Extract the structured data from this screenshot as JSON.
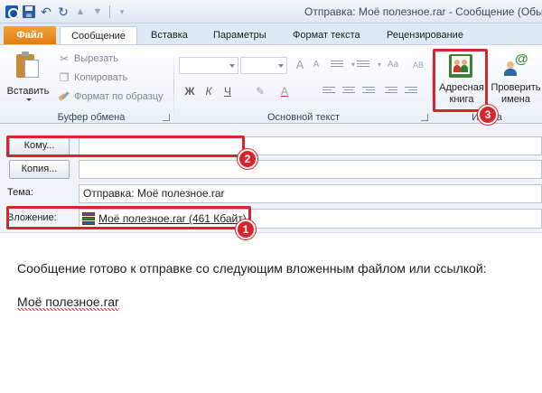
{
  "window": {
    "title": "Отправка: Моё полезное.rar  -  Сообщение (Обы"
  },
  "tabs": [
    {
      "label": "Файл"
    },
    {
      "label": "Сообщение"
    },
    {
      "label": "Вставка"
    },
    {
      "label": "Параметры"
    },
    {
      "label": "Формат текста"
    },
    {
      "label": "Рецензирование"
    }
  ],
  "ribbon": {
    "clipboard": {
      "paste_label": "Вставить",
      "cut_label": "Вырезать",
      "copy_label": "Копировать",
      "format_painter_label": "Формат по образцу",
      "group_label": "Буфер обмена"
    },
    "basic_text": {
      "group_label": "Основной текст",
      "bold": "Ж",
      "italic": "К",
      "underline": "Ч"
    },
    "names": {
      "address_book_line1": "Адресная",
      "address_book_line2": "книга",
      "check_names_line1": "Проверить",
      "check_names_line2": "имена",
      "group_label": "Имена"
    }
  },
  "header": {
    "to_button": "Кому...",
    "to_value": "",
    "cc_button": "Копия...",
    "cc_value": "",
    "subject_label": "Тема:",
    "subject_value": "Отправка: Моё полезное.rar",
    "attachment_label": "Вложение:",
    "attachment_value": "Моё полезное.rar (461 Кбайт)"
  },
  "body": {
    "line1": "Сообщение готово к отправке со следующим вложенным файлом или ссылкой:",
    "line2": "Моё полезное.rar"
  },
  "annotations": [
    {
      "label": "1"
    },
    {
      "label": "2"
    },
    {
      "label": "3"
    }
  ],
  "colors": {
    "highlight": "#d9232e",
    "file_tab": "#e07b10",
    "ribbon_bg": "#eaf0f7"
  }
}
